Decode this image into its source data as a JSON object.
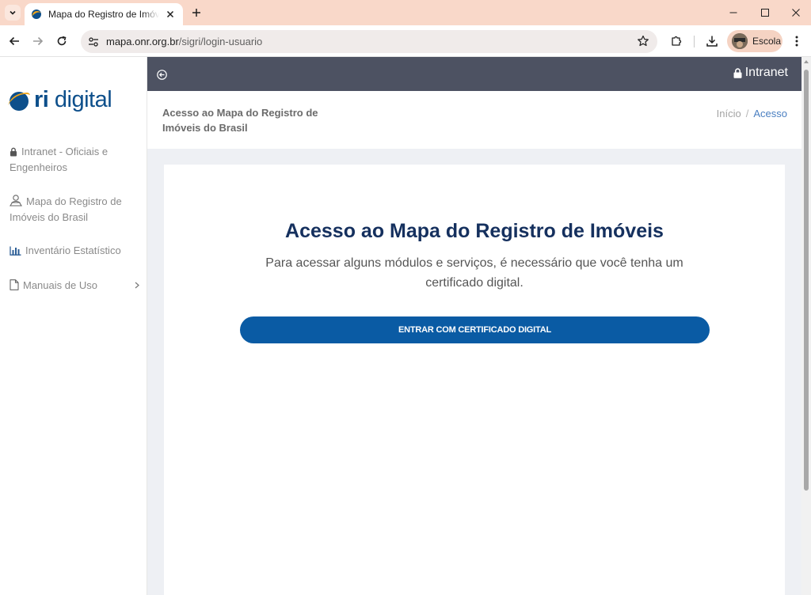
{
  "browser": {
    "tab_title": "Mapa do Registro de Imóveis do Brasil",
    "url_host": "mapa.onr.org.br",
    "url_path": "/sigri/login-usuario",
    "profile_name": "Escola",
    "colors": {
      "tabstrip": "#f9d8c9",
      "profile_chip": "#f5d3c3"
    }
  },
  "sidebar": {
    "logo_ri": "ri",
    "logo_digital": " digital",
    "items": [
      {
        "label": "Intranet - Oficiais e Engenheiros",
        "icon": "lock-icon"
      },
      {
        "label": "Mapa do Registro de Imóveis do Brasil",
        "icon": "map-user-icon"
      },
      {
        "label": "Inventário Estatístico",
        "icon": "bar-chart-icon"
      },
      {
        "label": "Manuais de Uso",
        "icon": "document-icon",
        "has_submenu": true
      }
    ]
  },
  "topbar": {
    "intranet_label": "Intranet",
    "color": "#4d5262"
  },
  "page_header": {
    "title": "Acesso ao Mapa do Registro de Imóveis do Brasil",
    "breadcrumb_home": "Início",
    "breadcrumb_separator": "/",
    "breadcrumb_current": "Acesso"
  },
  "card": {
    "title": "Acesso ao Mapa do Registro de Imóveis",
    "text": "Para acessar alguns módulos e serviços, é necessário que você tenha um certificado digital.",
    "button_label": "ENTRAR COM CERTIFICADO DIGITAL",
    "colors": {
      "title": "#15305e",
      "button": "#0a5ba4"
    }
  }
}
